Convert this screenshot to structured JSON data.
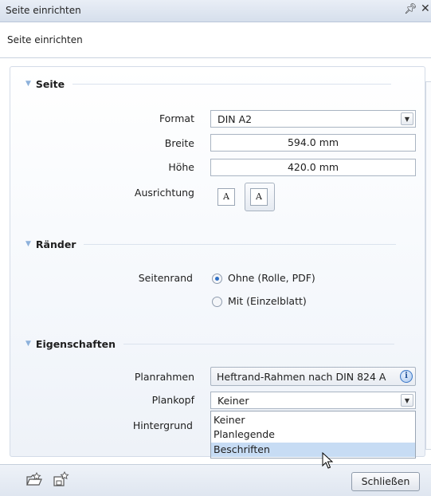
{
  "window": {
    "title": "Seite einrichten",
    "subtitle": "Seite einrichten"
  },
  "sections": {
    "seite": {
      "title": "Seite",
      "format_label": "Format",
      "format_value": "DIN A2",
      "breite_label": "Breite",
      "breite_value": "594.0 mm",
      "hoehe_label": "Höhe",
      "hoehe_value": "420.0 mm",
      "ausrichtung_label": "Ausrichtung",
      "ausrichtung_icon_portrait": "A",
      "ausrichtung_icon_landscape": "A",
      "ausrichtung_selected": "landscape"
    },
    "raender": {
      "title": "Ränder",
      "seitenrand_label": "Seitenrand",
      "options": [
        "Ohne (Rolle, PDF)",
        "Mit (Einzelblatt)"
      ],
      "selected": "Ohne (Rolle, PDF)"
    },
    "eigenschaften": {
      "title": "Eigenschaften",
      "planrahmen_label": "Planrahmen",
      "planrahmen_value": "Heftrand-Rahmen nach DIN 824 A",
      "plankopf_label": "Plankopf",
      "plankopf_value": "Keiner",
      "hintergrund_label": "Hintergrund",
      "plankopf_options": [
        "Keiner",
        "Planlegende",
        "Beschriften"
      ],
      "plankopf_highlighted": "Beschriften"
    }
  },
  "footer": {
    "close_label": "Schließen",
    "icons": [
      "open-folder-icon",
      "save-favorite-icon"
    ]
  },
  "colors": {
    "accent": "#2f6fc4",
    "highlight": "#c7dcf4",
    "section_triangle": "#8db1db"
  }
}
